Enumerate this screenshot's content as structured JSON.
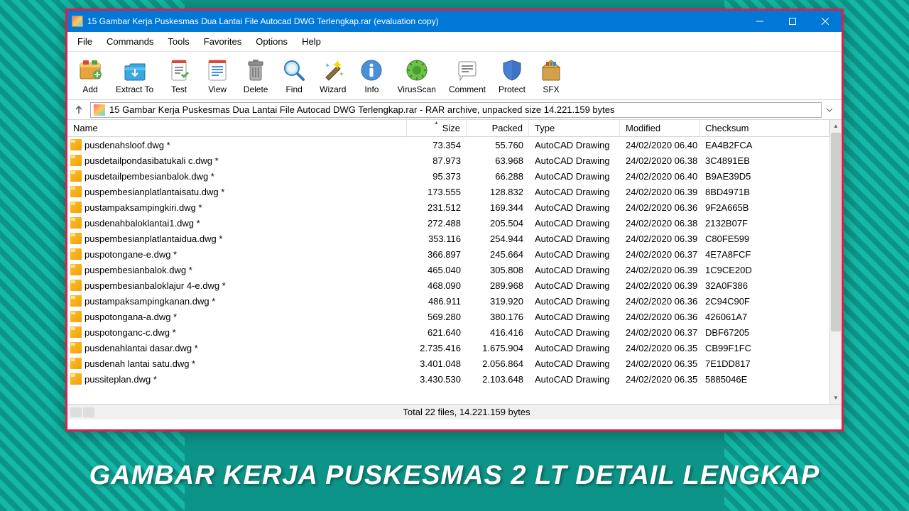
{
  "window": {
    "title": "15 Gambar Kerja Puskesmas Dua Lantai File Autocad DWG Terlengkap.rar (evaluation copy)"
  },
  "menu": [
    "File",
    "Commands",
    "Tools",
    "Favorites",
    "Options",
    "Help"
  ],
  "toolbar": [
    {
      "label": "Add",
      "icon": "add"
    },
    {
      "label": "Extract To",
      "icon": "extract"
    },
    {
      "label": "Test",
      "icon": "test"
    },
    {
      "label": "View",
      "icon": "view"
    },
    {
      "label": "Delete",
      "icon": "delete"
    },
    {
      "label": "Find",
      "icon": "find"
    },
    {
      "label": "Wizard",
      "icon": "wizard"
    },
    {
      "label": "Info",
      "icon": "info"
    },
    {
      "label": "VirusScan",
      "icon": "virusscan"
    },
    {
      "label": "Comment",
      "icon": "comment"
    },
    {
      "label": "Protect",
      "icon": "protect"
    },
    {
      "label": "SFX",
      "icon": "sfx"
    }
  ],
  "address": "15 Gambar Kerja Puskesmas Dua Lantai File Autocad DWG Terlengkap.rar - RAR archive, unpacked size 14.221.159 bytes",
  "columns": [
    "Name",
    "Size",
    "Packed",
    "Type",
    "Modified",
    "Checksum"
  ],
  "files": [
    {
      "name": "pusdenahsloof.dwg *",
      "size": "73.354",
      "packed": "55.760",
      "type": "AutoCAD Drawing",
      "modified": "24/02/2020 06.40",
      "checksum": "EA4B2FCA"
    },
    {
      "name": "pusdetailpondasibatukali c.dwg *",
      "size": "87.973",
      "packed": "63.968",
      "type": "AutoCAD Drawing",
      "modified": "24/02/2020 06.38",
      "checksum": "3C4891EB"
    },
    {
      "name": "pusdetailpembesianbalok.dwg *",
      "size": "95.373",
      "packed": "66.288",
      "type": "AutoCAD Drawing",
      "modified": "24/02/2020 06.40",
      "checksum": "B9AE39D5"
    },
    {
      "name": "puspembesianplatlantaisatu.dwg *",
      "size": "173.555",
      "packed": "128.832",
      "type": "AutoCAD Drawing",
      "modified": "24/02/2020 06.39",
      "checksum": "8BD4971B"
    },
    {
      "name": "pustampaksampingkiri.dwg *",
      "size": "231.512",
      "packed": "169.344",
      "type": "AutoCAD Drawing",
      "modified": "24/02/2020 06.36",
      "checksum": "9F2A665B"
    },
    {
      "name": "pusdenahbaloklantai1.dwg *",
      "size": "272.488",
      "packed": "205.504",
      "type": "AutoCAD Drawing",
      "modified": "24/02/2020 06.38",
      "checksum": "2132B07F"
    },
    {
      "name": "puspembesianplatlantaidua.dwg *",
      "size": "353.116",
      "packed": "254.944",
      "type": "AutoCAD Drawing",
      "modified": "24/02/2020 06.39",
      "checksum": "C80FE599"
    },
    {
      "name": "puspotongane-e.dwg *",
      "size": "366.897",
      "packed": "245.664",
      "type": "AutoCAD Drawing",
      "modified": "24/02/2020 06.37",
      "checksum": "4E7A8FCF"
    },
    {
      "name": "puspembesianbalok.dwg *",
      "size": "465.040",
      "packed": "305.808",
      "type": "AutoCAD Drawing",
      "modified": "24/02/2020 06.39",
      "checksum": "1C9CE20D"
    },
    {
      "name": "puspembesianbaloklajur 4-e.dwg *",
      "size": "468.090",
      "packed": "289.968",
      "type": "AutoCAD Drawing",
      "modified": "24/02/2020 06.39",
      "checksum": "32A0F386"
    },
    {
      "name": "pustampaksampingkanan.dwg *",
      "size": "486.911",
      "packed": "319.920",
      "type": "AutoCAD Drawing",
      "modified": "24/02/2020 06.36",
      "checksum": "2C94C90F"
    },
    {
      "name": "puspotongana-a.dwg *",
      "size": "569.280",
      "packed": "380.176",
      "type": "AutoCAD Drawing",
      "modified": "24/02/2020 06.36",
      "checksum": "426061A7"
    },
    {
      "name": "puspotonganc-c.dwg *",
      "size": "621.640",
      "packed": "416.416",
      "type": "AutoCAD Drawing",
      "modified": "24/02/2020 06.37",
      "checksum": "DBF67205"
    },
    {
      "name": "pusdenahlantai dasar.dwg *",
      "size": "2.735.416",
      "packed": "1.675.904",
      "type": "AutoCAD Drawing",
      "modified": "24/02/2020 06.35",
      "checksum": "CB99F1FC"
    },
    {
      "name": "pusdenah lantai satu.dwg *",
      "size": "3.401.048",
      "packed": "2.056.864",
      "type": "AutoCAD Drawing",
      "modified": "24/02/2020 06.35",
      "checksum": "7E1DD817"
    },
    {
      "name": "pussiteplan.dwg *",
      "size": "3.430.530",
      "packed": "2.103.648",
      "type": "AutoCAD Drawing",
      "modified": "24/02/2020 06.35",
      "checksum": "5885046E"
    }
  ],
  "status": "Total 22 files, 14.221.159 bytes",
  "caption": "GAMBAR KERJA PUSKESMAS 2 LT DETAIL LENGKAP"
}
